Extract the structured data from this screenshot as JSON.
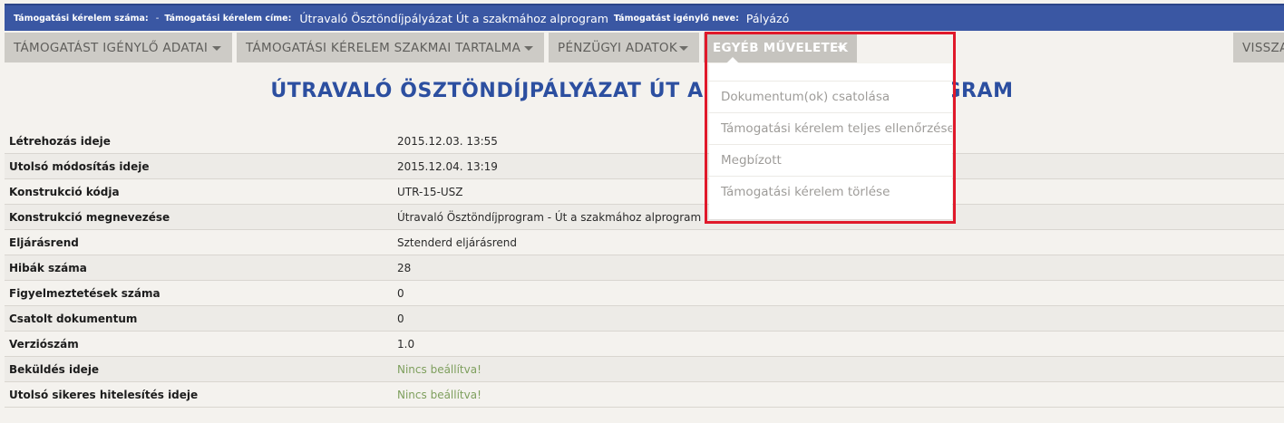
{
  "header": {
    "application_number_label": "Támogatási kérelem száma:",
    "application_number_value": "-",
    "application_title_label": "Támogatási kérelem címe:",
    "application_title_value": "Útravaló Ösztöndíjpályázat Út a szakmához alprogram",
    "applicant_name_label": "Támogatást igénylő neve:",
    "applicant_name_value": "Pályázó"
  },
  "nav": {
    "tabs": [
      {
        "label": "TÁMOGATÁST IGÉNYLŐ ADATAI"
      },
      {
        "label": "TÁMOGATÁSI KÉRELEM SZAKMAI TARTALMA"
      },
      {
        "label": "PÉNZÜGYI ADATOK"
      },
      {
        "label": "EGYÉB MŰVELETEK"
      },
      {
        "label": "VISSZA"
      }
    ]
  },
  "dropdown": {
    "items": [
      {
        "label": "Dokumentum(ok) csatolása"
      },
      {
        "label": "Támogatási kérelem teljes ellenőrzése"
      },
      {
        "label": "Megbízott"
      },
      {
        "label": "Támogatási kérelem törlése"
      }
    ]
  },
  "page": {
    "title": "ÚTRAVALÓ ÖSZTÖNDÍJPÁLYÁZAT ÚT A SZAKMÁHOZ ALPROGRAM"
  },
  "details": {
    "rows": [
      {
        "label": "Létrehozás ideje",
        "value": "2015.12.03. 13:55"
      },
      {
        "label": "Utolsó módosítás ideje",
        "value": "2015.12.04. 13:19"
      },
      {
        "label": "Konstrukció kódja",
        "value": "UTR-15-USZ"
      },
      {
        "label": "Konstrukció megnevezése",
        "value": "Útravaló Ösztöndíjprogram - Út a szakmához alprogram"
      },
      {
        "label": "Eljárásrend",
        "value": "Sztenderd eljárásrend"
      },
      {
        "label": "Hibák száma",
        "value": "28"
      },
      {
        "label": "Figyelmeztetések száma",
        "value": "0"
      },
      {
        "label": "Csatolt dokumentum",
        "value": "0"
      },
      {
        "label": "Verziószám",
        "value": "1.0"
      },
      {
        "label": "Beküldés ideje",
        "value": "Nincs beállítva!"
      },
      {
        "label": "Utolsó sikeres hitelesítés ideje",
        "value": "Nincs beállítva!"
      }
    ]
  },
  "colors": {
    "header_bg": "#3a57a3",
    "title": "#2c4fa0",
    "highlight": "#e0192a",
    "warning_value": "#7e9f5d"
  }
}
